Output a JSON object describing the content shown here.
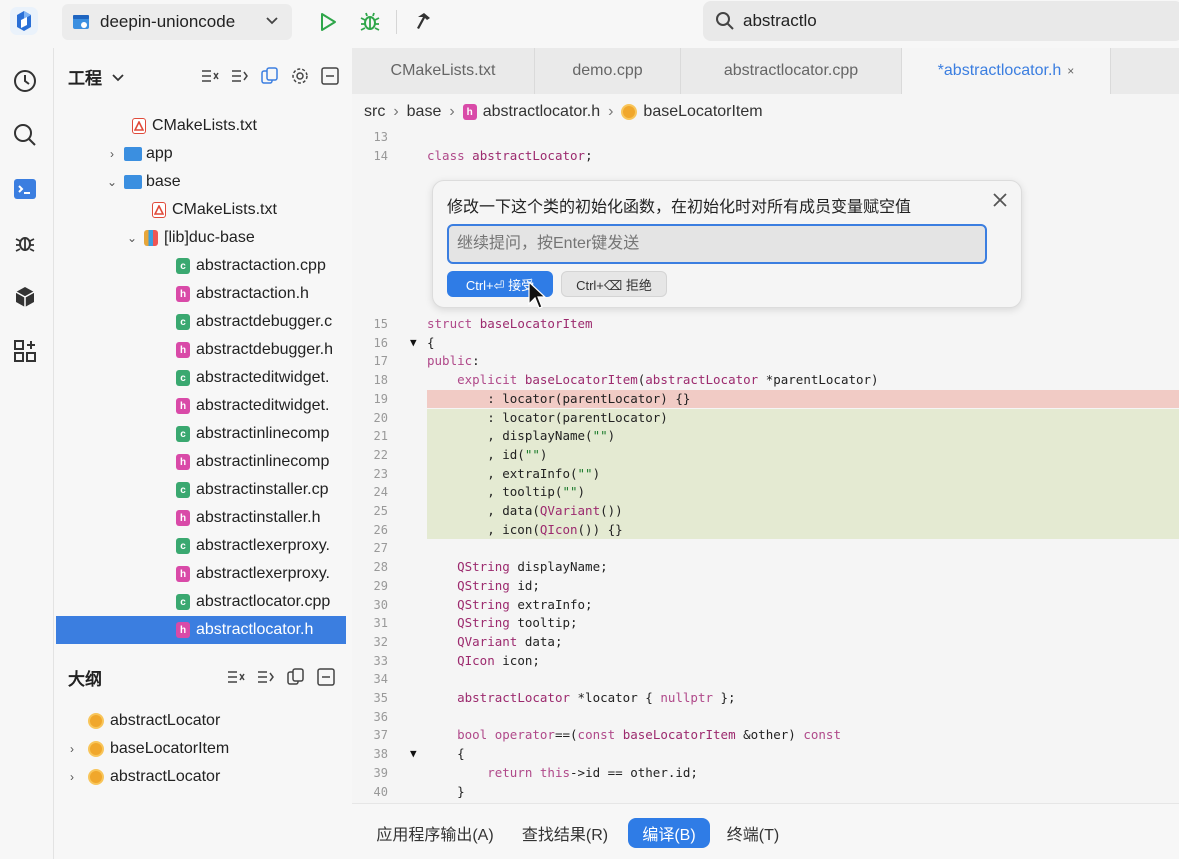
{
  "header": {
    "project_name": "deepin-unioncode",
    "search_value": "abstractlo"
  },
  "project_panel": {
    "title": "工程",
    "tree": [
      {
        "label": "CMakeLists.txt",
        "kind": "cmake",
        "indent": 1
      },
      {
        "label": "app",
        "kind": "folder",
        "indent": 0,
        "arrow": "›"
      },
      {
        "label": "base",
        "kind": "folder",
        "indent": 0,
        "arrow": "⌄"
      },
      {
        "label": "CMakeLists.txt",
        "kind": "cmake",
        "indent": 2
      },
      {
        "label": "[lib]duc-base",
        "kind": "lib",
        "indent": 1,
        "arrow": "⌄"
      },
      {
        "label": "abstractaction.cpp",
        "kind": "cpp",
        "indent": 3
      },
      {
        "label": "abstractaction.h",
        "kind": "hdr",
        "indent": 3
      },
      {
        "label": "abstractdebugger.c",
        "kind": "cpp",
        "indent": 3
      },
      {
        "label": "abstractdebugger.h",
        "kind": "hdr",
        "indent": 3
      },
      {
        "label": "abstracteditwidget.",
        "kind": "cpp",
        "indent": 3
      },
      {
        "label": "abstracteditwidget.",
        "kind": "hdr",
        "indent": 3
      },
      {
        "label": "abstractinlinecomp",
        "kind": "cpp",
        "indent": 3
      },
      {
        "label": "abstractinlinecomp",
        "kind": "hdr",
        "indent": 3
      },
      {
        "label": "abstractinstaller.cp",
        "kind": "cpp",
        "indent": 3
      },
      {
        "label": "abstractinstaller.h",
        "kind": "hdr",
        "indent": 3
      },
      {
        "label": "abstractlexerproxy.",
        "kind": "cpp",
        "indent": 3
      },
      {
        "label": "abstractlexerproxy.",
        "kind": "hdr",
        "indent": 3
      },
      {
        "label": "abstractlocator.cpp",
        "kind": "cpp",
        "indent": 3
      },
      {
        "label": "abstractlocator.h",
        "kind": "hdr",
        "indent": 3,
        "selected": true
      }
    ]
  },
  "outline_panel": {
    "title": "大纲",
    "items": [
      {
        "label": "abstractLocator",
        "arrow": ""
      },
      {
        "label": "baseLocatorItem",
        "arrow": "›"
      },
      {
        "label": "abstractLocator",
        "arrow": "›"
      }
    ]
  },
  "editor": {
    "tabs": [
      {
        "label": "CMakeLists.txt",
        "active": false
      },
      {
        "label": "demo.cpp",
        "active": false
      },
      {
        "label": "abstractlocator.cpp",
        "active": false
      },
      {
        "label": "*abstractlocator.h",
        "active": true,
        "close": "×"
      }
    ],
    "breadcrumb": [
      "src",
      "base",
      "abstractlocator.h",
      "baseLocatorItem"
    ],
    "breadcrumb_sep": "›",
    "lines": [
      {
        "n": "13",
        "text": ""
      },
      {
        "n": "14",
        "text": "class abstractLocator;"
      },
      {
        "n": "15",
        "text": "struct baseLocatorItem"
      },
      {
        "n": "16",
        "text": "{",
        "fold": "▼"
      },
      {
        "n": "17",
        "text": "public:"
      },
      {
        "n": "18",
        "text": "    explicit baseLocatorItem(abstractLocator *parentLocator)"
      },
      {
        "n": "19",
        "text": "        : locator(parentLocator) {}",
        "mark": "del"
      },
      {
        "n": "20",
        "text": "        : locator(parentLocator)",
        "mark": "add"
      },
      {
        "n": "21",
        "text": "        , displayName(\"\")",
        "mark": "add"
      },
      {
        "n": "22",
        "text": "        , id(\"\")",
        "mark": "add"
      },
      {
        "n": "23",
        "text": "        , extraInfo(\"\")",
        "mark": "add"
      },
      {
        "n": "24",
        "text": "        , tooltip(\"\")",
        "mark": "add"
      },
      {
        "n": "25",
        "text": "        , data(QVariant())",
        "mark": "add"
      },
      {
        "n": "26",
        "text": "        , icon(QIcon()) {}",
        "mark": "add"
      },
      {
        "n": "27",
        "text": ""
      },
      {
        "n": "28",
        "text": "    QString displayName;"
      },
      {
        "n": "29",
        "text": "    QString id;"
      },
      {
        "n": "30",
        "text": "    QString extraInfo;"
      },
      {
        "n": "31",
        "text": "    QString tooltip;"
      },
      {
        "n": "32",
        "text": "    QVariant data;"
      },
      {
        "n": "33",
        "text": "    QIcon icon;"
      },
      {
        "n": "34",
        "text": ""
      },
      {
        "n": "35",
        "text": "    abstractLocator *locator { nullptr };"
      },
      {
        "n": "36",
        "text": ""
      },
      {
        "n": "37",
        "text": "    bool operator==(const baseLocatorItem &other) const"
      },
      {
        "n": "38",
        "text": "    {",
        "fold": "▼"
      },
      {
        "n": "39",
        "text": "        return this->id == other.id;"
      },
      {
        "n": "40",
        "text": "    }"
      }
    ]
  },
  "ai_popup": {
    "prompt": "修改一下这个类的初始化函数，在初始化时对所有成员变量赋空值",
    "input_placeholder": "继续提问，按Enter键发送",
    "accept_label": "Ctrl+⏎ 接受",
    "reject_label": "Ctrl+⌫ 拒绝"
  },
  "bottom_tabs": [
    {
      "label": "应用程序输出(A)",
      "active": false
    },
    {
      "label": "查找结果(R)",
      "active": false
    },
    {
      "label": "编译(B)",
      "active": true
    },
    {
      "label": "终端(T)",
      "active": false
    }
  ],
  "colors": {
    "accent": "#2f7ce6",
    "deleted_line": "#f1cbc5",
    "added_line": "#e4ead2"
  }
}
